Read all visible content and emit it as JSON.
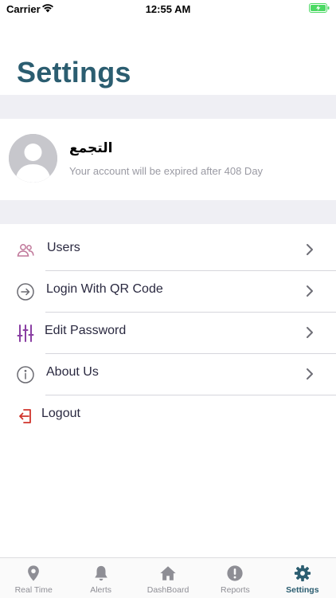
{
  "status_bar": {
    "carrier": "Carrier",
    "time": "12:55 AM"
  },
  "header": {
    "title": "Settings"
  },
  "account": {
    "name": "التجمع",
    "subtitle": "Your account will be expired after 408 Day"
  },
  "menu": {
    "items": [
      {
        "label": "Users",
        "icon": "users-icon",
        "color": "#c0789a"
      },
      {
        "label": "Login With QR Code",
        "icon": "arrow-circle-icon",
        "color": "#6b6b72"
      },
      {
        "label": "Edit Password",
        "icon": "sliders-icon",
        "color": "#8a3fa3"
      },
      {
        "label": "About Us",
        "icon": "info-circle-icon",
        "color": "#6b6b72"
      },
      {
        "label": "Logout",
        "icon": "logout-icon",
        "color": "#d0342c"
      }
    ]
  },
  "tab_bar": {
    "tabs": [
      {
        "label": "Real Time",
        "icon": "map-pin-icon"
      },
      {
        "label": "Alerts",
        "icon": "bell-icon"
      },
      {
        "label": "DashBoard",
        "icon": "home-icon"
      },
      {
        "label": "Reports",
        "icon": "exclamation-icon"
      },
      {
        "label": "Settings",
        "icon": "gear-icon",
        "active": true
      }
    ]
  },
  "colors": {
    "accent": "#2b5d70",
    "band": "#efeff4",
    "inactive_tab": "#8e8e95",
    "battery": "#4cd964"
  }
}
